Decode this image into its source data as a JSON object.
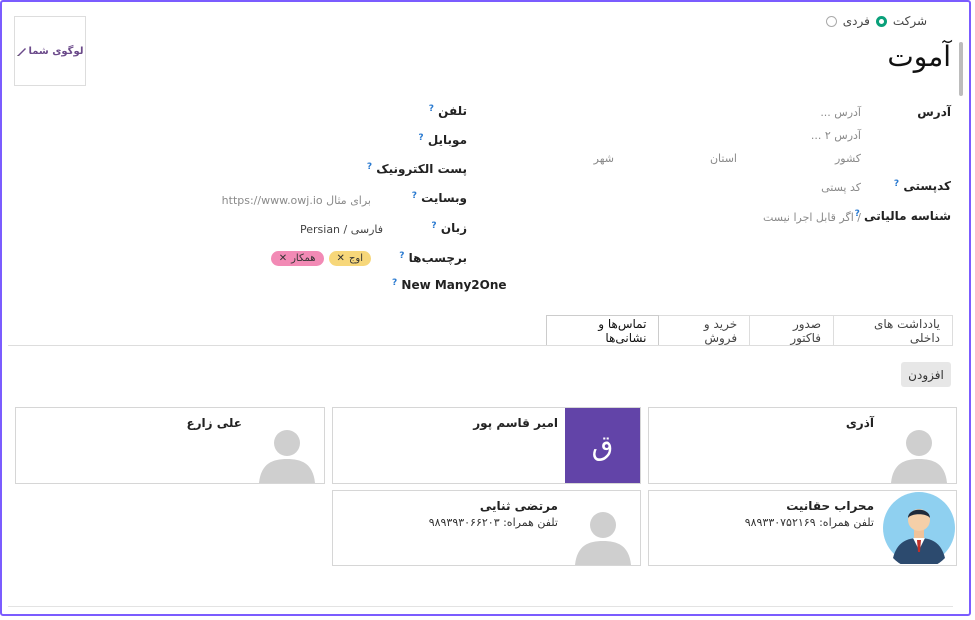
{
  "partner_type": {
    "individual_label": "فردی",
    "company_label": "شرکت",
    "selected": "company"
  },
  "company_name": "آموت",
  "logo_text": "لوگوی شما",
  "address": {
    "label": "آدرس",
    "street_placeholder": "آدرس ...",
    "street2_placeholder": "آدرس ۲ ...",
    "city_placeholder": "شهر",
    "state_placeholder": "استان",
    "country_placeholder": "کشور",
    "zip_label": "کدپستی",
    "zip_placeholder": "کد پستی",
    "tax_label": "شناسه مالیاتی",
    "tax_placeholder": "/ اگر قابل اجرا نیست"
  },
  "contact_fields": {
    "phone_label": "تلفن",
    "mobile_label": "موبایل",
    "email_label": "پست الکترونیک",
    "website_label": "وبسایت",
    "website_placeholder": "برای مثال  https://www.owj.io",
    "language_label": "زبان",
    "language_value": "Persian / فارسی",
    "tags_label": "برچسب‌ها",
    "tags": [
      "اوج",
      "همکار"
    ],
    "many2one_label": "New Many2One",
    "help_mark": "?"
  },
  "tabs": [
    "تماس‌ها و نشانی‌ها",
    "خرید و فروش",
    "صدور فاکتور",
    "یادداشت های داخلی"
  ],
  "add_button": "افزودن",
  "contacts": [
    {
      "name": "آذری",
      "phone": "",
      "avatar": "placeholder-silhouette"
    },
    {
      "name": "امیر قاسم پور",
      "phone": "",
      "avatar": "letter-tile",
      "letter": "ق"
    },
    {
      "name": "علی زارع",
      "phone": "",
      "avatar": "placeholder-silhouette"
    },
    {
      "name": "محراب حقانیت",
      "phone": "تلفن همراه: ۹۸۹۳۳۰۷۵۲۱۶۹",
      "avatar": "man-in-suit"
    },
    {
      "name": "مرتضی ثنایی",
      "phone": "تلفن همراه: ۹۸۹۳۹۳۰۶۶۲۰۳",
      "avatar": "placeholder-silhouette"
    }
  ],
  "colors": {
    "accent_green": "#0aa07a",
    "frame_purple": "#7b5cff",
    "letter_tile": "#6244a8",
    "tag_yellow": "#f7d77a",
    "tag_pink": "#f28ab5"
  }
}
